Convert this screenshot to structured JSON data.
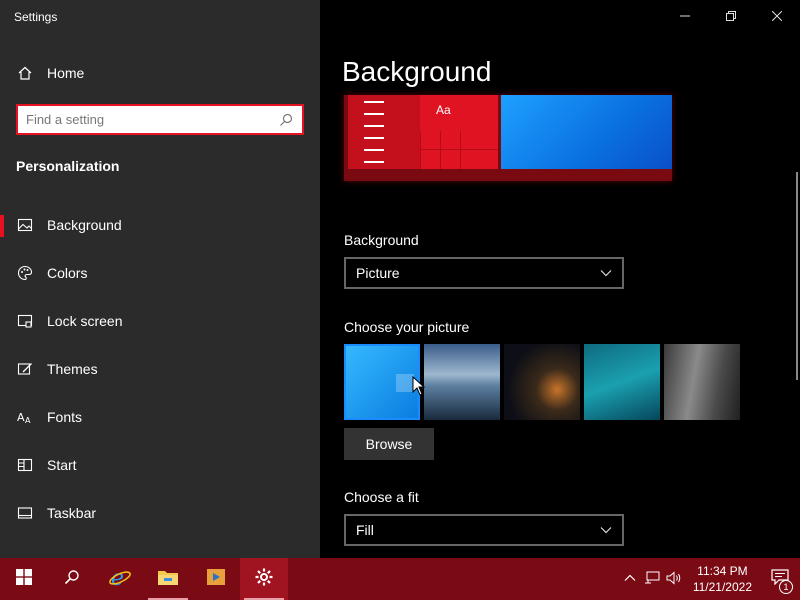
{
  "window": {
    "title": "Settings",
    "minimize": "—",
    "restore": "❐",
    "close": "✕"
  },
  "sidebar": {
    "home_label": "Home",
    "search_placeholder": "Find a setting",
    "section_title": "Personalization",
    "items": [
      {
        "label": "Background",
        "icon": "picture-icon",
        "active": true
      },
      {
        "label": "Colors",
        "icon": "palette-icon"
      },
      {
        "label": "Lock screen",
        "icon": "lock-screen-icon"
      },
      {
        "label": "Themes",
        "icon": "themes-icon"
      },
      {
        "label": "Fonts",
        "icon": "fonts-icon"
      },
      {
        "label": "Start",
        "icon": "start-icon"
      },
      {
        "label": "Taskbar",
        "icon": "taskbar-icon"
      }
    ]
  },
  "main": {
    "title": "Background",
    "preview_aa": "Aa",
    "background_label": "Background",
    "background_value": "Picture",
    "choose_picture_label": "Choose your picture",
    "browse_label": "Browse",
    "choose_fit_label": "Choose a fit",
    "fit_value": "Fill"
  },
  "taskbar": {
    "time": "11:34 PM",
    "date": "11/21/2022",
    "notification_count": "1"
  },
  "colors": {
    "accent": "#e81123",
    "taskbar": "#7a0a14",
    "sidebar": "#2b2b2b"
  }
}
